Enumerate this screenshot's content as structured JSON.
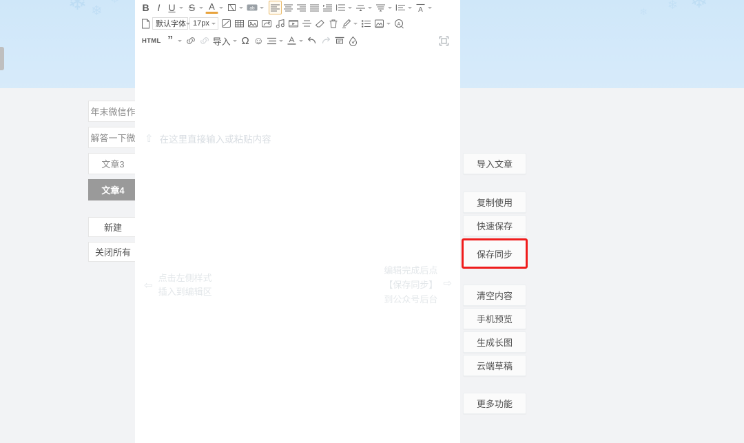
{
  "background": {
    "banner_gradient_top": "#cfe7f9",
    "banner_gradient_bottom": "#f2f3f5",
    "snowflake_color": "#bcdcf4",
    "snowflake_glyph": "❄"
  },
  "left_panel": {
    "article_tabs": [
      {
        "label": "年末微信作",
        "active": false
      },
      {
        "label": "解答一下微",
        "active": false
      },
      {
        "label": "文章3",
        "active": false
      },
      {
        "label": "文章4",
        "active": true
      }
    ],
    "actions": [
      {
        "label": "新建"
      },
      {
        "label": "关闭所有"
      }
    ]
  },
  "editor": {
    "toolbar_row1": [
      {
        "name": "bold-icon",
        "glyph": "B",
        "style": "bold",
        "caret": false,
        "active": false
      },
      {
        "name": "italic-icon",
        "glyph": "I",
        "style": "italic",
        "caret": false,
        "active": false
      },
      {
        "name": "underline-icon",
        "glyph": "U",
        "style": "underline",
        "caret": true,
        "active": false
      },
      {
        "name": "strikethrough-icon",
        "glyph": "S",
        "style": "strike",
        "caret": true,
        "active": false
      },
      {
        "name": "font-color-icon",
        "glyph": "A",
        "style": "fontcolor",
        "caret": true,
        "active": false
      },
      {
        "name": "highlight-color-icon",
        "glyph": "▧",
        "style": "icon",
        "caret": true,
        "active": false
      },
      {
        "name": "remove-format-icon",
        "glyph": "ab",
        "style": "chip",
        "caret": true,
        "active": false
      },
      {
        "name": "align-left-icon",
        "glyph": "≡",
        "style": "icon",
        "caret": false,
        "active": true
      },
      {
        "name": "align-center-icon",
        "glyph": "≡",
        "style": "icon",
        "caret": false,
        "active": false
      },
      {
        "name": "align-right-icon",
        "glyph": "≡",
        "style": "icon",
        "caret": false,
        "active": false
      },
      {
        "name": "align-justify-icon",
        "glyph": "≡",
        "style": "icon",
        "caret": false,
        "active": false
      },
      {
        "name": "indent-increase-icon",
        "glyph": "≡",
        "style": "icon",
        "caret": false,
        "active": false
      },
      {
        "name": "line-height-icon",
        "glyph": "≡",
        "style": "icon",
        "caret": true,
        "active": false
      },
      {
        "name": "letter-spacing-icon",
        "glyph": "≡",
        "style": "icon",
        "caret": true,
        "active": false
      },
      {
        "name": "paragraph-spacing-icon",
        "glyph": "≡",
        "style": "icon",
        "caret": true,
        "active": false
      },
      {
        "name": "list-indent-icon",
        "glyph": "≡",
        "style": "icon",
        "caret": true,
        "active": false
      },
      {
        "name": "clear-style-icon",
        "glyph": "A",
        "style": "clearA",
        "caret": true,
        "active": false
      }
    ],
    "font_family_value": "默认字体",
    "font_size_value": "17px",
    "toolbar_row2": [
      {
        "name": "new-page-icon",
        "glyph": "file"
      },
      {
        "name": "image-split-icon",
        "glyph": "slash-box"
      },
      {
        "name": "table-icon",
        "glyph": "table"
      },
      {
        "name": "insert-image-icon",
        "glyph": "picture"
      },
      {
        "name": "gallery-icon",
        "glyph": "gallery"
      },
      {
        "name": "music-icon",
        "glyph": "music"
      },
      {
        "name": "video-icon",
        "glyph": "video"
      },
      {
        "name": "divider-icon",
        "glyph": "hr"
      },
      {
        "name": "eraser-icon",
        "glyph": "eraser"
      },
      {
        "name": "trash-icon",
        "glyph": "trash"
      },
      {
        "name": "format-brush-icon",
        "glyph": "brush",
        "caret": true
      },
      {
        "name": "ordered-list-icon",
        "glyph": "olist"
      },
      {
        "name": "background-image-icon",
        "glyph": "bgimg",
        "caret": true
      },
      {
        "name": "find-replace-icon",
        "glyph": "findA"
      }
    ],
    "toolbar_row3": [
      {
        "name": "html-source-button",
        "glyph": "HTML",
        "style": "text"
      },
      {
        "name": "quote-icon",
        "glyph": "”",
        "caret": true
      },
      {
        "name": "link-icon",
        "glyph": "link"
      },
      {
        "name": "unlink-icon",
        "glyph": "unlink"
      },
      {
        "name": "import-button",
        "glyph": "导入",
        "style": "text",
        "caret": true
      },
      {
        "name": "special-character-icon",
        "glyph": "Ω"
      },
      {
        "name": "emoji-icon",
        "glyph": "☺"
      },
      {
        "name": "bullet-list-icon",
        "glyph": "list",
        "caret": true
      },
      {
        "name": "text-template-icon",
        "glyph": "tmpl",
        "caret": true
      },
      {
        "name": "undo-icon",
        "glyph": "undo"
      },
      {
        "name": "redo-icon",
        "glyph": "redo"
      },
      {
        "name": "header-footer-icon",
        "glyph": "hdr"
      },
      {
        "name": "watermark-icon",
        "glyph": "water"
      }
    ],
    "fullscreen_icon_name": "fullscreen-icon",
    "placeholder": "在这里直接输入或粘贴内容",
    "placeholder_arrow": "⇧",
    "hint_left_lines": [
      "点击左侧样式",
      "插入到编辑区"
    ],
    "hint_left_arrow": "⇦",
    "hint_right_lines": [
      "编辑完成后点",
      "【保存同步】",
      "到公众号后台"
    ],
    "hint_right_arrow": "⇨"
  },
  "right_panel": {
    "import_button": "导入文章",
    "groups": [
      {
        "items": [
          "复制使用",
          "快速保存"
        ]
      },
      {
        "items": [
          "清空内容",
          "手机预览",
          "生成长图",
          "云端草稿"
        ]
      },
      {
        "items": [
          "更多功能"
        ]
      }
    ],
    "highlighted_button": {
      "label": "保存同步",
      "outline_color": "#f01c1c"
    }
  }
}
